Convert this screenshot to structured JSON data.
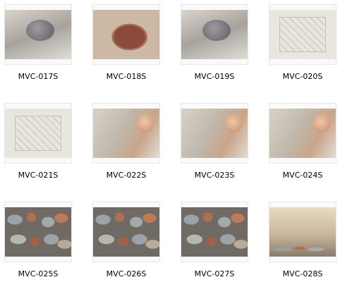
{
  "thumbnails": [
    {
      "caption": "MVC-017S"
    },
    {
      "caption": "MVC-018S"
    },
    {
      "caption": "MVC-019S"
    },
    {
      "caption": "MVC-020S"
    },
    {
      "caption": "MVC-021S"
    },
    {
      "caption": "MVC-022S"
    },
    {
      "caption": "MVC-023S"
    },
    {
      "caption": "MVC-024S"
    },
    {
      "caption": "MVC-025S"
    },
    {
      "caption": "MVC-026S"
    },
    {
      "caption": "MVC-027S"
    },
    {
      "caption": "MVC-028S"
    }
  ]
}
